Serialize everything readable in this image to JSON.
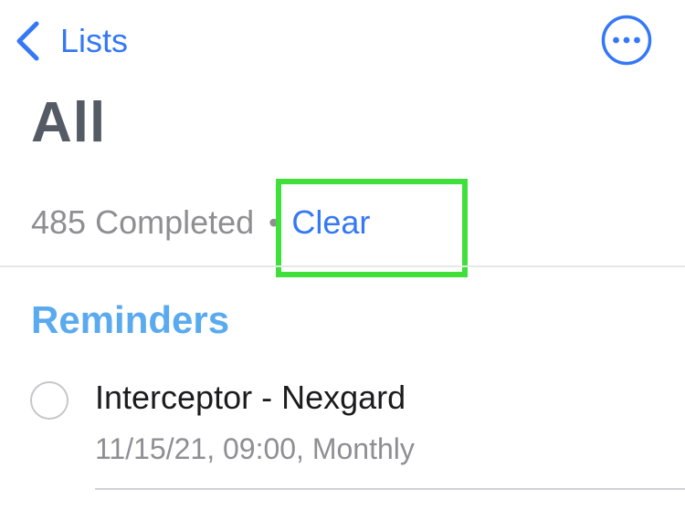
{
  "nav": {
    "back_label": "Lists",
    "back_icon": "chevron-left-icon",
    "more_icon": "ellipsis-circle-icon",
    "accent_color": "#3478f6"
  },
  "header": {
    "title": "All",
    "completed_count": "485 Completed",
    "separator": "•",
    "clear_label": "Clear"
  },
  "annotation": {
    "highlight_color": "#3fe03a"
  },
  "sections": [
    {
      "title": "Reminders",
      "title_color": "#59aaee",
      "items": [
        {
          "title": "Interceptor - Nexgard",
          "subtitle": "11/15/21, 09:00, Monthly",
          "completed": false
        }
      ]
    }
  ]
}
